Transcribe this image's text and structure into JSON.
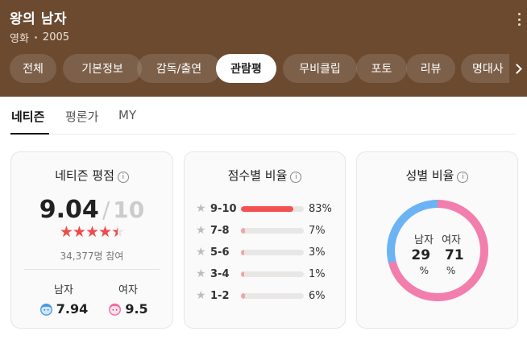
{
  "header": {
    "title": "왕의 남자",
    "category": "영화",
    "year": "2005",
    "bg_color": "#6b4a30"
  },
  "tabs": [
    {
      "label": "전체"
    },
    {
      "label": "기본정보"
    },
    {
      "label": "감독/출연"
    },
    {
      "label": "관람평",
      "active": true
    },
    {
      "label": "무비클립"
    },
    {
      "label": "포토"
    },
    {
      "label": "리뷰"
    },
    {
      "label": "명대사"
    }
  ],
  "subtabs": [
    {
      "label": "네티즌",
      "active": true
    },
    {
      "label": "평론가"
    },
    {
      "label": "MY"
    }
  ],
  "netizen_rating": {
    "title": "네티즌 평점",
    "info_icon": "ⓘ",
    "score": "9.04",
    "slash": "/",
    "max": "10",
    "stars_value": 4.52,
    "participants": "34,377명 참여",
    "male_label": "남자",
    "male_score": "7.94",
    "female_label": "여자",
    "female_score": "9.5"
  },
  "score_distribution": {
    "title": "점수별 비율",
    "info_icon": "ⓘ",
    "rows": [
      {
        "range": "9-10",
        "percent": 83,
        "label": "83%",
        "color": "#f45252"
      },
      {
        "range": "7-8",
        "percent": 7,
        "label": "7%",
        "color": "#f5a3a3"
      },
      {
        "range": "5-6",
        "percent": 3,
        "label": "3%",
        "color": "#f5a3a3"
      },
      {
        "range": "3-4",
        "percent": 1,
        "label": "1%",
        "color": "#f5a3a3"
      },
      {
        "range": "1-2",
        "percent": 6,
        "label": "6%",
        "color": "#f5a3a3"
      }
    ]
  },
  "gender_ratio": {
    "title": "성별 비율",
    "info_icon": "ⓘ",
    "male_label": "남자",
    "female_label": "여자",
    "male_value": "29",
    "female_value": "71",
    "unit": "%",
    "male_percent": 29,
    "female_percent": 71,
    "male_color": "#6bb3f5",
    "female_color": "#f27eae"
  }
}
